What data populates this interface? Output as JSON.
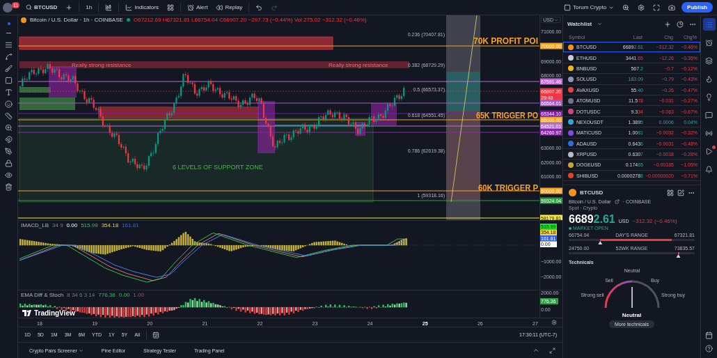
{
  "topbar": {
    "notifications": "11",
    "symbol": "BTCUSD",
    "interval": "1h",
    "indicators": "Indicators",
    "alert": "Alert",
    "replay": "Replay",
    "layout_name": "Torum Crypto",
    "publish": "Publish"
  },
  "chart": {
    "title": "Bitcoin / U.S. Dollar · 1h · COINBASE",
    "ohlc": "O67212.69 H67321.81 L66754.04 C66907.20 −297.73 (−0.44%) Vol 275.02 −312.32 (−0.46%)",
    "currency": "USD",
    "price_ticks": [
      "71000.00",
      "69000.00",
      "68000.00",
      "63000.00",
      "62000.00",
      "61000.00"
    ],
    "price_badges": [
      {
        "label": "70000.00",
        "color": "#f7a21b"
      },
      {
        "label": "67591.46",
        "color": "#c06bdc"
      },
      {
        "label": "66907.20",
        "sub": "29:48",
        "color": "#f23645"
      },
      {
        "label": "66564.01",
        "color": "#a35cc6"
      },
      {
        "label": "65344.10",
        "color": "#7b1fa2"
      },
      {
        "label": "65000.00",
        "color": "#f7a21b"
      },
      {
        "label": "64521.01",
        "color": "#b673d8"
      },
      {
        "label": "64260.97",
        "color": "#8e24aa"
      },
      {
        "label": "60000.00",
        "color": "#f7a21b"
      },
      {
        "label": "59324.04",
        "color": "#2e9d44"
      },
      {
        "label": "58179.81",
        "color": "#f5e94a"
      }
    ],
    "resistance_labels": [
      "Really strong resistance",
      "Really strong resistance"
    ],
    "fib_levels": [
      "0.236 (70407.81)",
      "0.382 (68729.29)",
      "0.5 (66573.37)",
      "0.618 (64551.45)",
      "0.786 (62619.38)",
      "1 (59318.16)"
    ],
    "callouts": [
      "70K PROFIT POI",
      "65K TRIGGER PO",
      "60K TRIGGER P"
    ],
    "support_label": "6 LEVELS OF SUPPORT ZONE"
  },
  "macd": {
    "legend": [
      {
        "text": "IMACD_LB",
        "kind": "title"
      },
      {
        "text": "34 9",
        "kind": "params"
      },
      {
        "text": "0.00",
        "kind": "zero"
      },
      {
        "text": "515.99",
        "kind": "fast"
      },
      {
        "text": "354.18",
        "kind": "histogram"
      },
      {
        "text": "161.81",
        "kind": "slow"
      }
    ],
    "badges": [
      {
        "label": "515.99",
        "color": "#22e02e"
      },
      {
        "label": "354.18",
        "color": "#f5d53a"
      },
      {
        "label": "161.81",
        "color": "#2962ff"
      },
      {
        "label": "0.00",
        "color": "#ffffff"
      }
    ],
    "ticks": [
      "−1000.00",
      "−2000.00"
    ]
  },
  "ema": {
    "legend": [
      {
        "text": "EMA Diff & Stoch",
        "kind": "title"
      },
      {
        "text": "8 34 6 3 14",
        "kind": "params"
      },
      {
        "text": "776.36",
        "kind": "fast"
      },
      {
        "text": "0.00",
        "kind": "fast"
      },
      {
        "text": "1.00",
        "kind": "bound"
      }
    ],
    "ticks": [
      "2000.00",
      "0.00"
    ],
    "badge": {
      "label": "776.36",
      "color": "#2e9d44"
    },
    "branding": "TradingView"
  },
  "time_axis": [
    {
      "text": "18",
      "bold": false
    },
    {
      "text": "19",
      "bold": false
    },
    {
      "text": "20",
      "bold": false
    },
    {
      "text": "21",
      "bold": false
    },
    {
      "text": "22",
      "bold": false
    },
    {
      "text": "23",
      "bold": false
    },
    {
      "text": "24",
      "bold": false
    },
    {
      "text": "25",
      "bold": true
    },
    {
      "text": "26",
      "bold": false
    },
    {
      "text": "27",
      "bold": false
    }
  ],
  "ranges": [
    "1D",
    "5D",
    "1M",
    "3M",
    "6M",
    "YTD",
    "1Y",
    "5Y",
    "All"
  ],
  "clock": "17:30:11 (UTC-7)",
  "bottom_tabs": [
    {
      "label": "Crypto Pairs Screener",
      "has_menu": true
    },
    {
      "label": "Pine Editor",
      "has_menu": false
    },
    {
      "label": "Strategy Tester",
      "has_menu": false
    },
    {
      "label": "Trading Panel",
      "has_menu": false
    }
  ],
  "watchlist": {
    "title": "Watchlist",
    "columns": [
      "Symbol",
      "Last",
      "Chg",
      "Chg%"
    ],
    "rows": [
      {
        "symbol": "BTCUSD",
        "last": "6689",
        "tick": "2.61",
        "tick_up": true,
        "chg": "−312.32",
        "chg_pct": "−0.46%",
        "up": false,
        "color": "#f7931a",
        "selected": true
      },
      {
        "symbol": "ETHUSD",
        "last": "3441",
        "tick": ".65",
        "tick_up": false,
        "chg": "−12.26",
        "chg_pct": "−0.35%",
        "up": false,
        "color": "#c9cde0",
        "selected": false
      },
      {
        "symbol": "BNBUSD",
        "last": "567",
        "tick": ".2",
        "tick_up": true,
        "chg": "−0.7",
        "chg_pct": "−0.12%",
        "up": false,
        "color": "#f0b90b",
        "selected": false
      },
      {
        "symbol": "SOLUSD",
        "tick": "183.09",
        "tick_up": true,
        "chg": "−0.79",
        "chg_pct": "−0.43%",
        "up": false,
        "color": "#8f94b8",
        "selected": false
      },
      {
        "symbol": "AVAXUSD",
        "last": "55",
        "tick": ".40",
        "tick_up": true,
        "chg": "−0.26",
        "chg_pct": "−0.47%",
        "up": false,
        "color": "#e84142",
        "selected": false
      },
      {
        "symbol": "ATOMUSD",
        "last": "11.5",
        "tick": "78",
        "tick_up": false,
        "chg": "−0.031",
        "chg_pct": "−0.27%",
        "up": false,
        "color": "#6f7390",
        "selected": false
      },
      {
        "symbol": "DOTUSDC",
        "last": "9.3",
        "tick": "34",
        "tick_up": false,
        "chg": "−0.063",
        "chg_pct": "−0.67%",
        "up": false,
        "color": "#d0457f",
        "selected": false
      },
      {
        "symbol": "NEXOUSDT",
        "last": "1.389",
        "tick": "5",
        "tick_up": true,
        "chg": "0.0006",
        "chg_pct": "0.04%",
        "up": true,
        "color": "#2fa8d8",
        "selected": false
      },
      {
        "symbol": "MATICUSD",
        "last": "1.00",
        "tick": "81",
        "tick_up": true,
        "chg": "−0.0032",
        "chg_pct": "−0.32%",
        "up": false,
        "color": "#8247e5",
        "selected": false
      },
      {
        "symbol": "ADAUSD",
        "last": "0.643",
        "tick": "6",
        "tick_up": true,
        "chg": "−0.0031",
        "chg_pct": "−0.48%",
        "up": false,
        "color": "#2a6fdb",
        "selected": false
      },
      {
        "symbol": "XRPUSD",
        "last": "0.630",
        "tick": "7",
        "tick_up": true,
        "chg": "−0.0018",
        "chg_pct": "−0.28%",
        "up": false,
        "color": "#b8bbc4",
        "selected": false
      },
      {
        "symbol": "DOGEUSD",
        "last": "0.174",
        "tick": "65",
        "tick_up": true,
        "chg": "−0.00185",
        "chg_pct": "−1.05%",
        "up": false,
        "color": "#c2a633",
        "selected": false
      },
      {
        "symbol": "SHIBUSD",
        "last": "0.0000278",
        "tick": "8",
        "tick_up": true,
        "chg": "−0.00000020",
        "chg_pct": "−0.71%",
        "up": false,
        "color": "#e44328",
        "selected": false
      }
    ]
  },
  "details": {
    "symbol": "BTCUSD",
    "name": "Bitcoin / U.S. Dollar",
    "exchange": "· COINBASE",
    "category": "Spot · Crypto",
    "last": "6689",
    "tick": "2.61",
    "currency": "USD",
    "change": "−312.32 (−0.46%)",
    "status": "MARKET OPEN",
    "day_range": {
      "low": "66754.04",
      "label": "DAY'S RANGE",
      "high": "67321.81",
      "marker": {
        "level": 0.25
      },
      "fill": {
        "level": 0.82
      }
    },
    "year_range": {
      "low": "24750.00",
      "label": "52WK RANGE",
      "high": "73835.57",
      "marker": {
        "level": 0.87
      },
      "fill": {
        "level": 0.88
      }
    }
  },
  "technicals": {
    "title": "Technicals",
    "labels": [
      "Strong sell",
      "Sell",
      "Neutral",
      "Buy",
      "Strong buy"
    ],
    "verdict": "Neutral",
    "button": "More technicals"
  },
  "right_rail": [
    {
      "selected": true,
      "alert": false
    },
    {
      "selected": false,
      "alert": false
    },
    {
      "selected": false,
      "alert": false
    },
    {
      "selected": false,
      "alert": false
    },
    {
      "selected": false,
      "alert": false
    },
    {
      "selected": false,
      "alert": false
    },
    {
      "selected": false,
      "alert": false
    },
    {
      "selected": false,
      "alert": true
    },
    {
      "selected": false,
      "alert": false
    }
  ]
}
